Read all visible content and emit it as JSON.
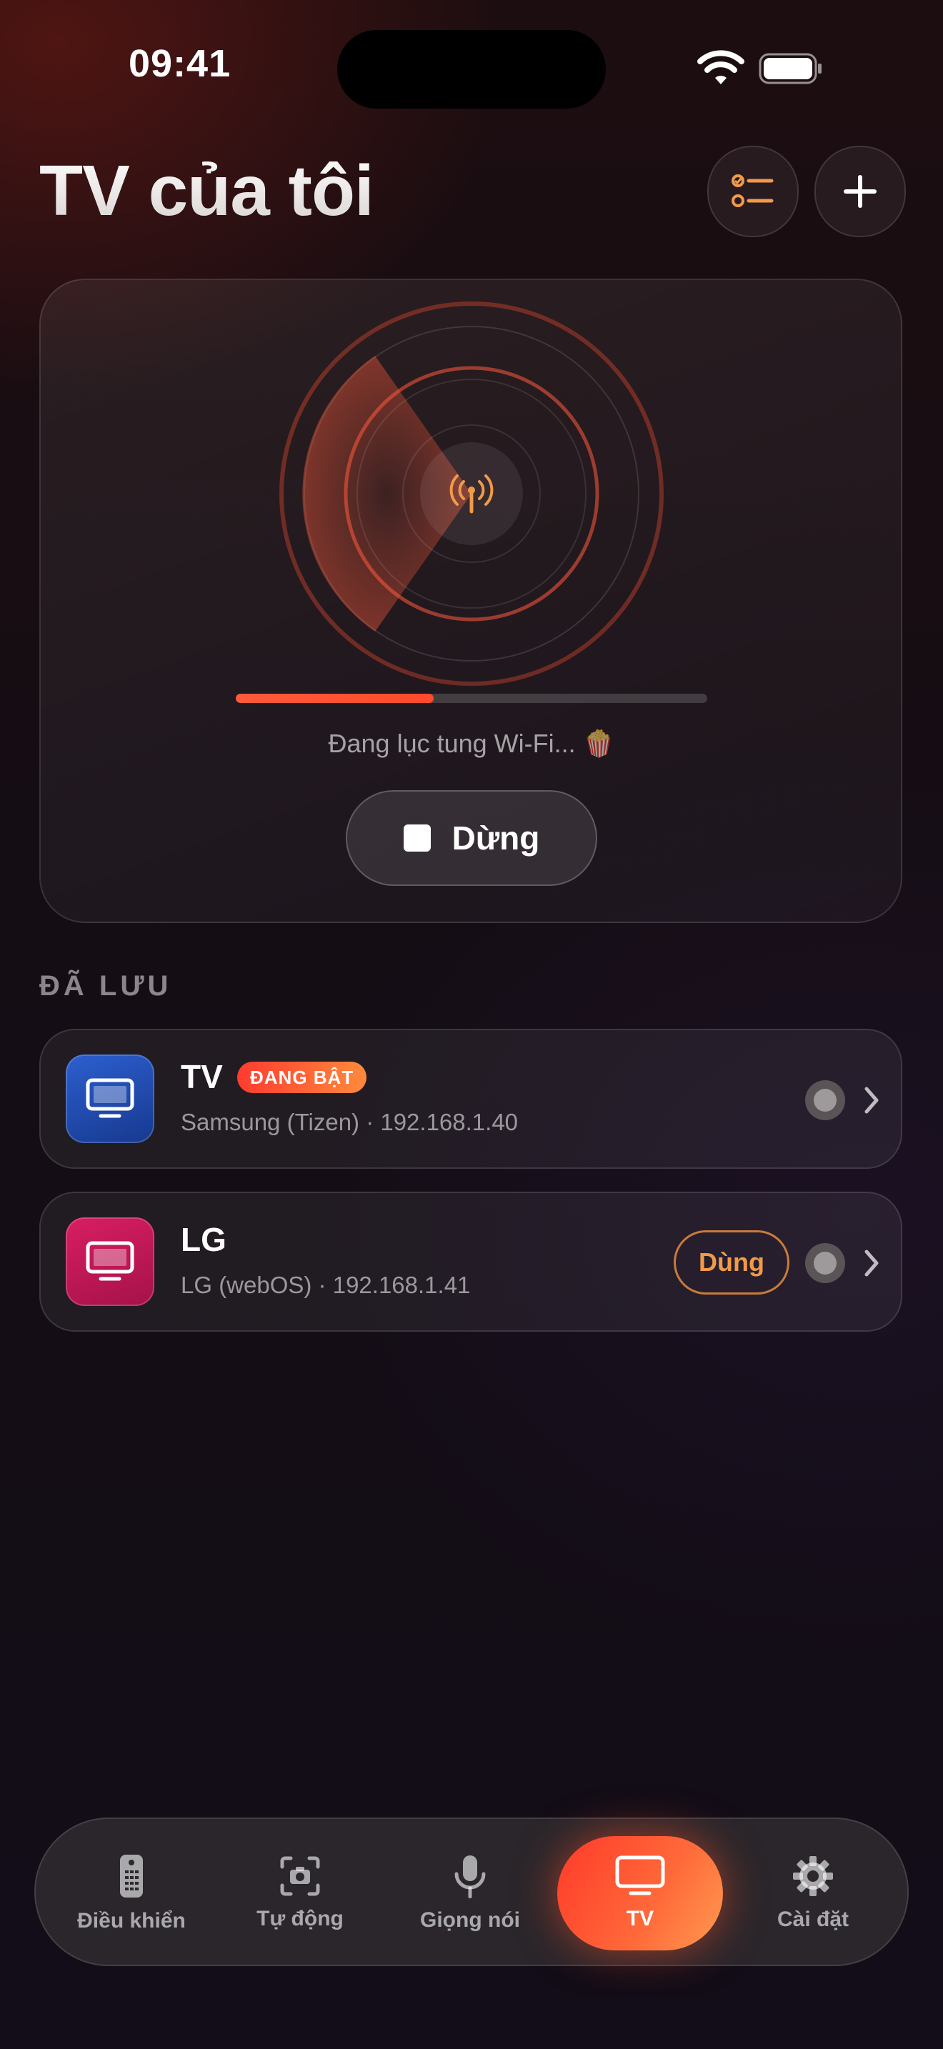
{
  "status_bar": {
    "time": "09:41"
  },
  "header": {
    "title": "TV của tôi"
  },
  "scan": {
    "progress": 0.42,
    "status_text": "Đang lục tung Wi-Fi... 🍿",
    "stop_label": "Dừng"
  },
  "saved": {
    "section_label": "ĐÃ LƯU",
    "devices": [
      {
        "name": "TV",
        "badge": "ĐANG BẬT",
        "subtitle": "Samsung (Tizen) · 192.168.1.40"
      },
      {
        "name": "LG",
        "subtitle": "LG (webOS) · 192.168.1.41",
        "use_label": "Dùng"
      }
    ]
  },
  "tabbar": {
    "items": [
      {
        "label": "Điều khiển",
        "icon": "remote-icon"
      },
      {
        "label": "Tự động",
        "icon": "camera-scan-icon"
      },
      {
        "label": "Giọng nói",
        "icon": "microphone-icon"
      },
      {
        "label": "TV",
        "icon": "tv-icon",
        "active": true
      },
      {
        "label": "Cài đặt",
        "icon": "gear-icon"
      }
    ]
  },
  "colors": {
    "accent": "#ff4a2c",
    "accent_orange": "#f19a4a",
    "background": "#150d14"
  }
}
